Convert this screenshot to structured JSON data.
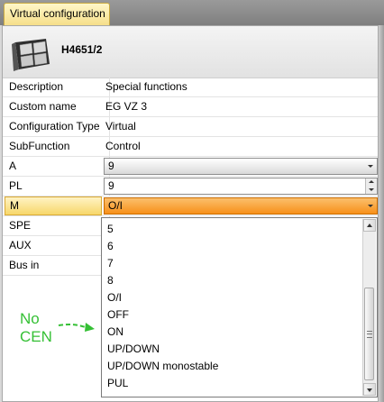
{
  "tab": {
    "label": "Virtual configuration"
  },
  "device": {
    "code": "H4651/2",
    "icon": "keypad-module-icon"
  },
  "properties": [
    {
      "label": "Description",
      "value": "Special functions",
      "kind": "text"
    },
    {
      "label": "Custom name",
      "value": " EG VZ 3",
      "kind": "text"
    },
    {
      "label": "Configuration Type",
      "value": "Virtual",
      "kind": "text"
    },
    {
      "label": "SubFunction",
      "value": "Control",
      "kind": "text"
    },
    {
      "label": "A",
      "value": "9",
      "kind": "combo"
    },
    {
      "label": "PL",
      "value": "9",
      "kind": "spinner"
    },
    {
      "label": "M",
      "value": "O/I",
      "kind": "combo-active"
    },
    {
      "label": "SPE",
      "value": "",
      "kind": "text"
    },
    {
      "label": "AUX",
      "value": "",
      "kind": "text"
    },
    {
      "label": "Bus in",
      "value": "",
      "kind": "text"
    }
  ],
  "dropdown": {
    "options": [
      "5",
      "6",
      "7",
      "8",
      "O/I",
      "OFF",
      "ON",
      "UP/DOWN",
      "UP/DOWN monostable",
      "PUL"
    ]
  },
  "annotation": {
    "line1": "No",
    "line2": "CEN",
    "color": "#35c035"
  },
  "colors": {
    "accent_orange": "#f7901a",
    "tab_yellow": "#f6df8a"
  }
}
